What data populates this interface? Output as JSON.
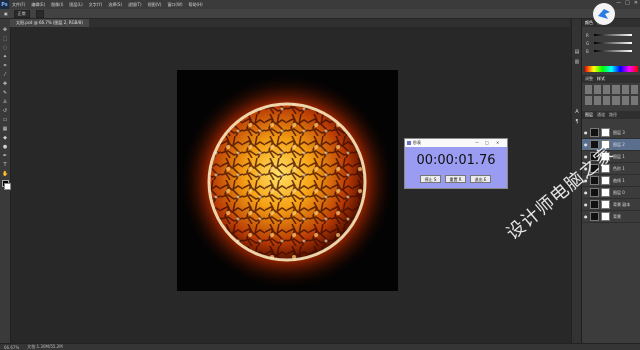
{
  "menubar": {
    "logo": "Ps",
    "items": [
      "文件(F)",
      "编辑(E)",
      "图像(I)",
      "图层(L)",
      "文字(Y)",
      "选择(S)",
      "滤镜(T)",
      "视图(V)",
      "窗口(W)",
      "帮助(H)"
    ],
    "controls": [
      "—",
      "□",
      "✕"
    ]
  },
  "options_bar": {
    "mode_value": "正常"
  },
  "document": {
    "tab_title": "太阳.psd @ 66.7% (图层 2, RGB/8)"
  },
  "status": {
    "zoom": "66.67%",
    "doc_info": "文档:1.30M/55.2M"
  },
  "panels": {
    "color_tabs": [
      "颜色",
      "色板"
    ],
    "sliders": [
      "R",
      "G",
      "B"
    ],
    "style_tabs": [
      "调整",
      "样式"
    ],
    "layer_tabs": [
      "图层",
      "通道",
      "路径"
    ],
    "layers": [
      {
        "name": "图层 3"
      },
      {
        "name": "图层 2"
      },
      {
        "name": "图层 1"
      },
      {
        "name": "色阶 1"
      },
      {
        "name": "曲线 1"
      },
      {
        "name": "图层 0"
      },
      {
        "name": "背景 副本"
      },
      {
        "name": "背景"
      }
    ]
  },
  "stopwatch": {
    "title": "秒表",
    "time": "00:00:01.76",
    "buttons": {
      "pause": "停止 S",
      "reset": "重置 R",
      "exit": "退出 E"
    },
    "controls": [
      "—",
      "□",
      "✕"
    ]
  },
  "watermark": "设计师电脑之家",
  "colors": {
    "sun_core": "#f5a014",
    "sun_glow": "#ff4a00",
    "stopwatch_bg": "#9a9cf2"
  }
}
